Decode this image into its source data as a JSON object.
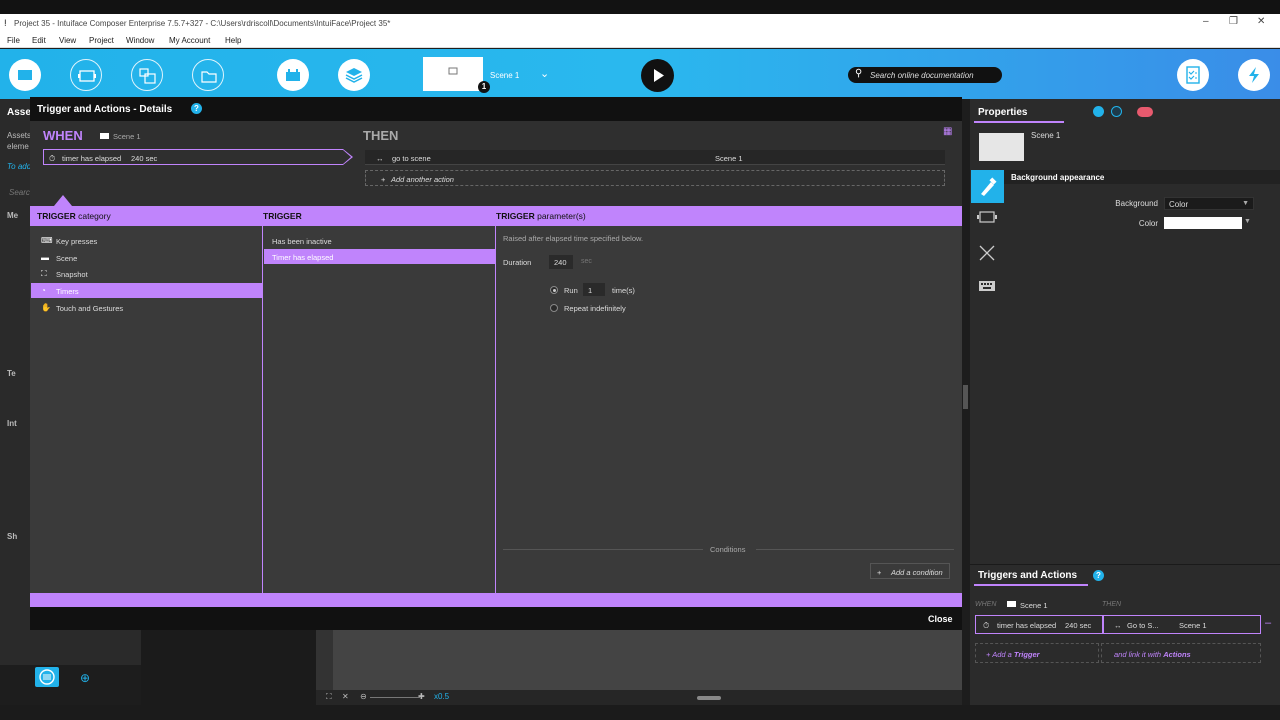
{
  "window": {
    "title": "Project 35 - Intuiface Composer Enterprise 7.5.7+327 - C:\\Users\\rdriscoll\\Documents\\IntuiFace\\Project 35*"
  },
  "menu": [
    "File",
    "Edit",
    "View",
    "Project",
    "Window",
    "My Account",
    "Help"
  ],
  "toolbar": {
    "scene_name": "Scene 1",
    "scene_badge": "1",
    "search_placeholder": "Search online documentation",
    "accent": "#22b2ea"
  },
  "left_fragment": {
    "assets_title": "Asse",
    "line1": "Assets",
    "line2": "eleme",
    "line3": "To add",
    "search": "Searc",
    "section_media": "Me",
    "section_text": "Te",
    "section_interactive": "Int",
    "section_shapes": "Sh"
  },
  "dialog": {
    "title": "Trigger and Actions - Details",
    "help": "?",
    "when_label": "WHEN",
    "when_scene": "Scene 1",
    "then_label": "THEN",
    "trigger_text": "timer has elapsed",
    "trigger_value": "240 sec",
    "action_text": "go to scene",
    "action_target": "Scene 1",
    "add_action": "Add another action",
    "headers": {
      "category_bold": "TRIGGER",
      "category_rest": " category",
      "trigger": "TRIGGER",
      "params_bold": "TRIGGER",
      "params_rest": " parameter(s)"
    },
    "categories": [
      {
        "label": "Key presses",
        "icon": "keyboard-icon"
      },
      {
        "label": "Scene",
        "icon": "scene-icon"
      },
      {
        "label": "Snapshot",
        "icon": "snapshot-icon"
      },
      {
        "label": "Timers",
        "icon": "timer-icon",
        "selected": true
      },
      {
        "label": "Touch and Gestures",
        "icon": "hand-icon"
      }
    ],
    "triggers": [
      {
        "label": "Has been inactive"
      },
      {
        "label": "Timer has elapsed",
        "selected": true
      }
    ],
    "params": {
      "description": "Raised after elapsed time specified below.",
      "duration_label": "Duration",
      "duration_value": "240",
      "duration_unit": "sec",
      "run_label": "Run",
      "run_value": "1",
      "run_unit": "time(s)",
      "repeat_label": "Repeat indefinitely",
      "selected_option": "run"
    },
    "conditions_label": "Conditions",
    "add_condition": "Add a condition",
    "close": "Close",
    "accent": "#c084fc"
  },
  "properties": {
    "title": "Properties",
    "scene_name": "Scene 1",
    "section": "Background appearance",
    "background_label": "Background",
    "background_value": "Color",
    "color_label": "Color",
    "color_value": "#ffffff"
  },
  "triggers_actions": {
    "title": "Triggers and Actions",
    "help": "?",
    "when": "WHEN",
    "scene": "Scene 1",
    "then": "THEN",
    "trigger_text": "timer has elapsed",
    "trigger_value": "240 sec",
    "action_text": "Go to S...",
    "action_target": "Scene 1",
    "add_trigger_prefix": "Add a ",
    "add_trigger_bold": "Trigger",
    "link_prefix": "and link it with ",
    "link_bold": "Actions"
  },
  "canvas": {
    "zoom": "x0.5"
  }
}
